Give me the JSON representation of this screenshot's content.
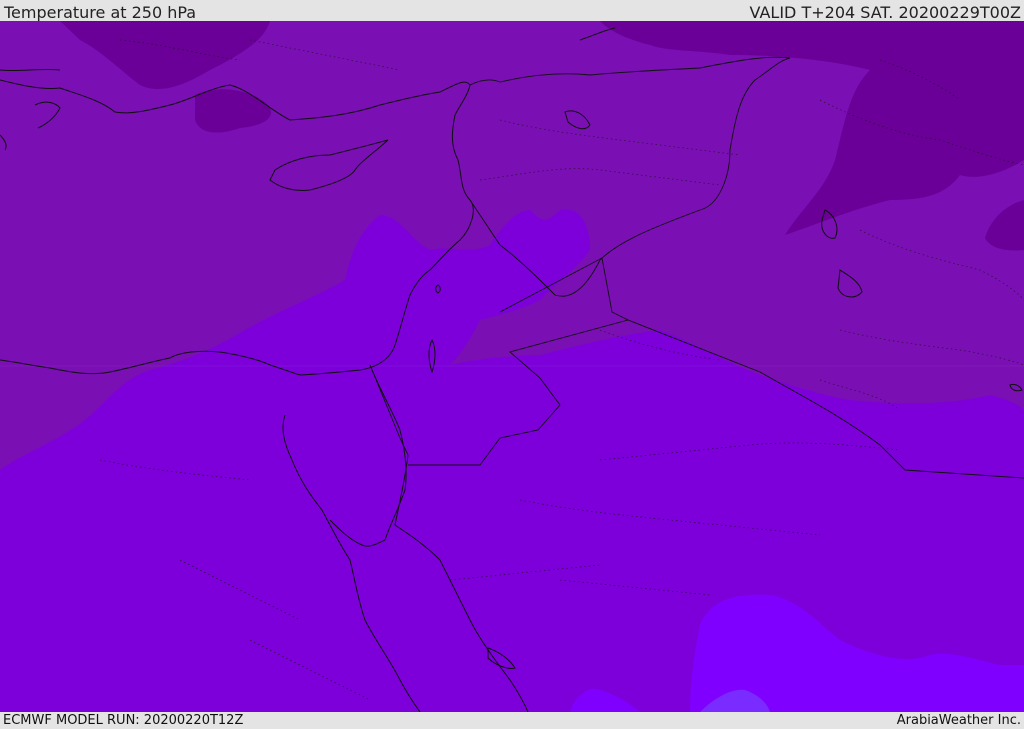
{
  "header": {
    "title": "Temperature at 250 hPa",
    "valid": "VALID T+204 SAT. 20200229T00Z"
  },
  "footer": {
    "model_run": "ECMWF MODEL RUN: 20200220T12Z",
    "credit": "ArabiaWeather Inc."
  },
  "map": {
    "colors": {
      "darkest": "#6b0099",
      "dark": "#7a0fb3",
      "mid": "#7d00db",
      "light": "#7f00ff",
      "lightest": "#7a2bff",
      "border": "#111111"
    }
  }
}
